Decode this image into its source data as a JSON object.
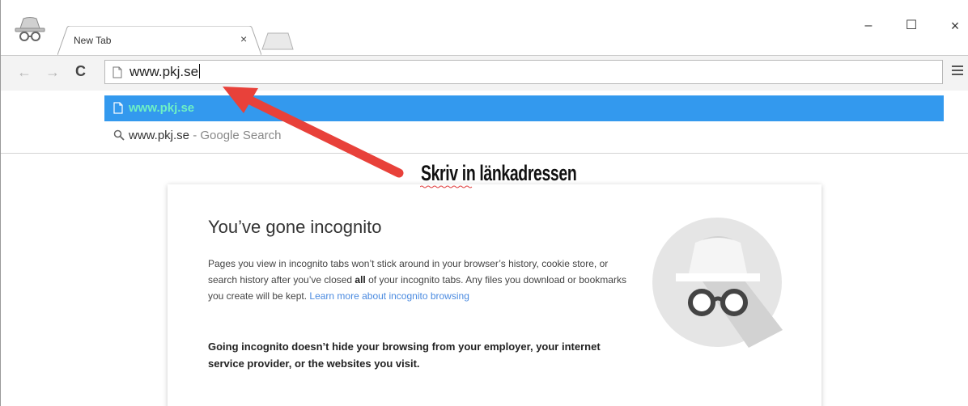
{
  "browser": {
    "tab_title": "New Tab",
    "tab_close": "×",
    "window_controls": {
      "minimize": "–",
      "maximize": "☐",
      "close": "×"
    },
    "nav": {
      "back": "←",
      "forward": "→",
      "reload": "C"
    },
    "omnibox_value": "www.pkj.se",
    "menu_icon": "hamburger-menu-icon"
  },
  "autocomplete": {
    "suggestions": [
      {
        "icon": "page-icon",
        "text": "www.pkj.se",
        "description": "",
        "selected": true
      },
      {
        "icon": "search-icon",
        "text": "www.pkj.se",
        "description": " - Google Search",
        "selected": false
      }
    ]
  },
  "incognito_page": {
    "title": "You’ve gone incognito",
    "paragraph_1": "Pages you view in incognito tabs won’t stick around in your browser’s history, cookie store, or search history after you’ve closed ",
    "paragraph_bold": "all",
    "paragraph_2": " of your incognito tabs. Any files you download or bookmarks you create will be kept. ",
    "learn_more": "Learn more about incognito browsing",
    "warning": "Going incognito doesn’t hide your browsing from your employer, your internet service provider, or the websites you visit."
  },
  "annotation": {
    "text": "Skriv in länkadressen",
    "arrow_color": "#e8413a"
  },
  "colors": {
    "selection_blue": "#3399ee",
    "selection_text": "#6ef0c4",
    "link": "#4a8ae0",
    "toolbar_bg": "#f3f3f3"
  }
}
